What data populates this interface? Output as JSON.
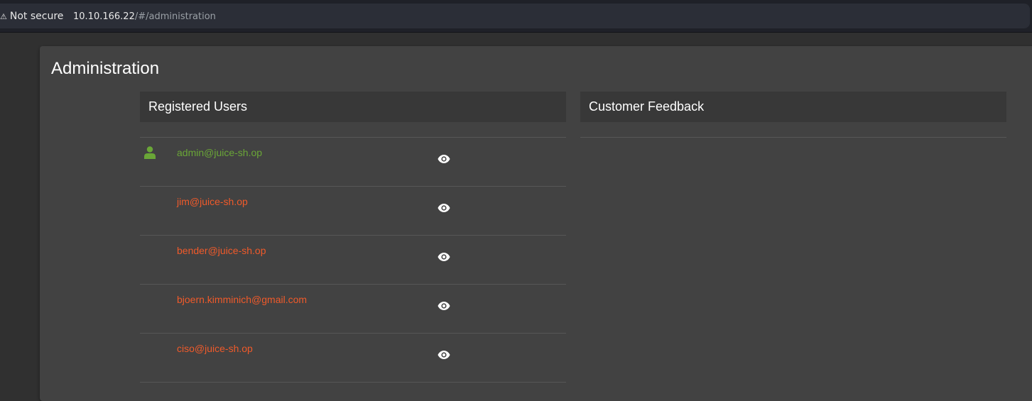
{
  "browser": {
    "security_label": "Not secure",
    "url_host": "10.10.166.22",
    "url_path": "/#/administration"
  },
  "page": {
    "title": "Administration"
  },
  "registered_users": {
    "title": "Registered Users",
    "users": [
      {
        "email": "admin@juice-sh.op",
        "color": "#6aa637",
        "icon": "person-icon"
      },
      {
        "email": "jim@juice-sh.op",
        "color": "#f05a2a",
        "icon": null
      },
      {
        "email": "bender@juice-sh.op",
        "color": "#f05a2a",
        "icon": null
      },
      {
        "email": "bjoern.kimminich@gmail.com",
        "color": "#f05a2a",
        "icon": null
      },
      {
        "email": "ciso@juice-sh.op",
        "color": "#f05a2a",
        "icon": null
      }
    ]
  },
  "customer_feedback": {
    "title": "Customer Feedback"
  },
  "colors": {
    "background": "#303030",
    "card": "#424242",
    "panel_header": "#383838",
    "admin_accent": "#6aa637",
    "customer_accent": "#f05a2a"
  }
}
